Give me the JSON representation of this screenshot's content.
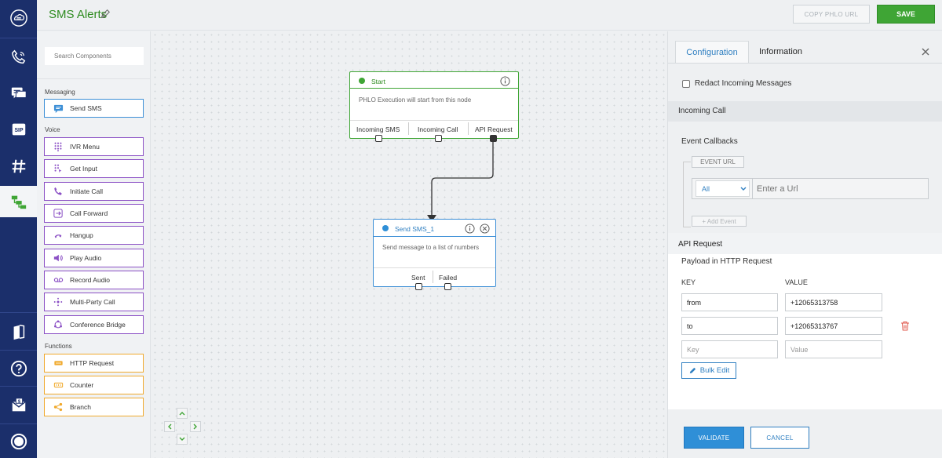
{
  "app": {
    "title": "SMS Alerts"
  },
  "toolbar": {
    "copy_label": "COPY PHLO URL",
    "save_label": "SAVE"
  },
  "rail": {
    "items": [
      "logo-icon",
      "phone-icon",
      "messaging-icon",
      "sip-icon",
      "number-icon",
      "phlo-icon",
      "docs-icon",
      "help-icon",
      "billing-icon",
      "account-icon"
    ]
  },
  "components": {
    "search_placeholder": "Search Components",
    "sections": {
      "messaging": "Messaging",
      "voice": "Voice",
      "functions": "Functions"
    },
    "items": {
      "send_sms": "Send SMS",
      "ivr_menu": "IVR Menu",
      "get_input": "Get Input",
      "initiate_call": "Initiate Call",
      "call_forward": "Call Forward",
      "hangup": "Hangup",
      "play_audio": "Play Audio",
      "record_audio": "Record Audio",
      "multi_party_call": "Multi-Party Call",
      "conference_bridge": "Conference Bridge",
      "http_request": "HTTP Request",
      "counter": "Counter",
      "branch": "Branch"
    }
  },
  "canvas": {
    "start_node": {
      "title": "Start",
      "description": "PHLO Execution will start from this node",
      "ports": [
        "Incoming SMS",
        "Incoming Call",
        "API Request"
      ]
    },
    "sms_node": {
      "title": "Send SMS_1",
      "description": "Send message to a list of numbers",
      "ports": [
        "Sent",
        "Failed"
      ]
    }
  },
  "config": {
    "tabs": {
      "configuration": "Configuration",
      "information": "Information"
    },
    "redact_label": "Redact Incoming Messages",
    "incoming_call": "Incoming Call",
    "event_callbacks": "Event Callbacks",
    "event_url_tag": "EVENT URL",
    "event_select": "All",
    "event_url_placeholder": "Enter a Url",
    "add_event": "+ Add Event",
    "api_request": "API Request",
    "payload_label": "Payload in HTTP Request",
    "key_header": "KEY",
    "value_header": "VALUE",
    "rows": [
      {
        "key": "from",
        "value": "+12065313758"
      },
      {
        "key": "to",
        "value": "+12065313767"
      }
    ],
    "key_placeholder": "Key",
    "value_placeholder": "Value",
    "bulk_edit": "Bulk Edit",
    "validate": "VALIDATE",
    "cancel": "CANCEL"
  },
  "colors": {
    "rail": "#1b2f6b",
    "accent_green": "#3fa535",
    "accent_blue": "#2f8fd7",
    "voice_purple": "#8b50c5",
    "function_orange": "#f0a92c"
  }
}
